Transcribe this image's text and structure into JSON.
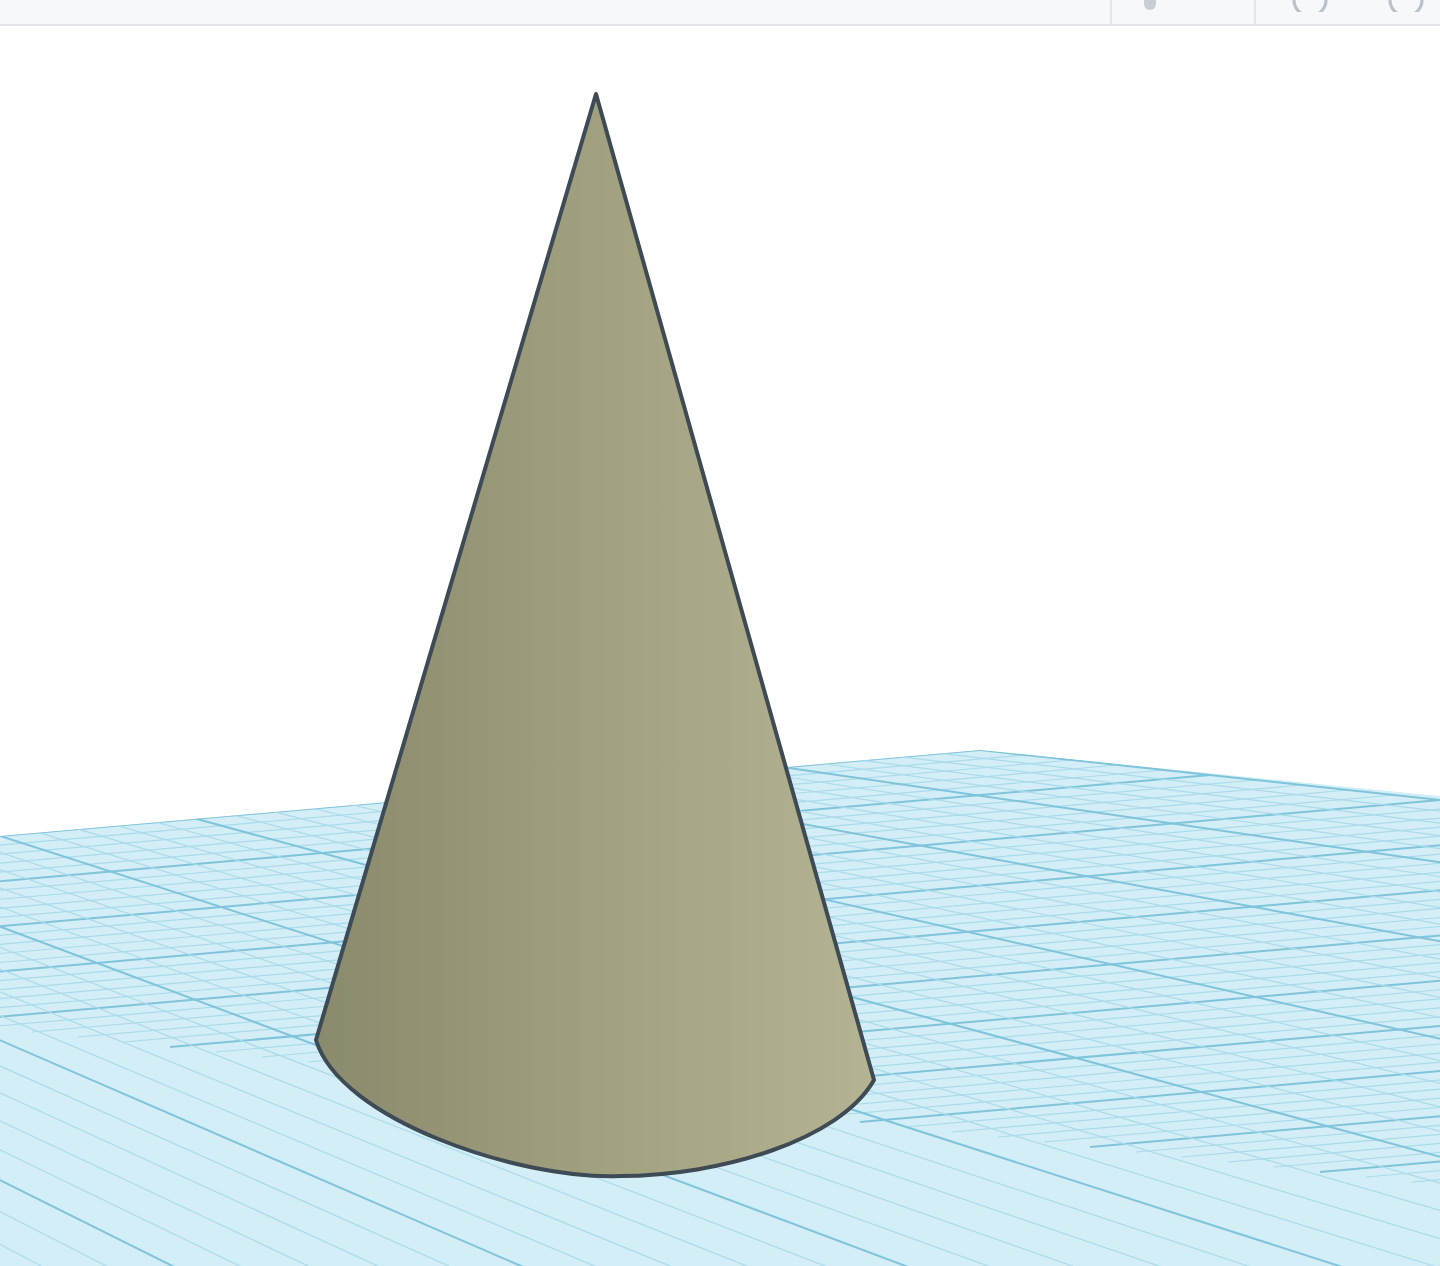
{
  "scene": {
    "object": {
      "kind": "cone"
    }
  }
}
